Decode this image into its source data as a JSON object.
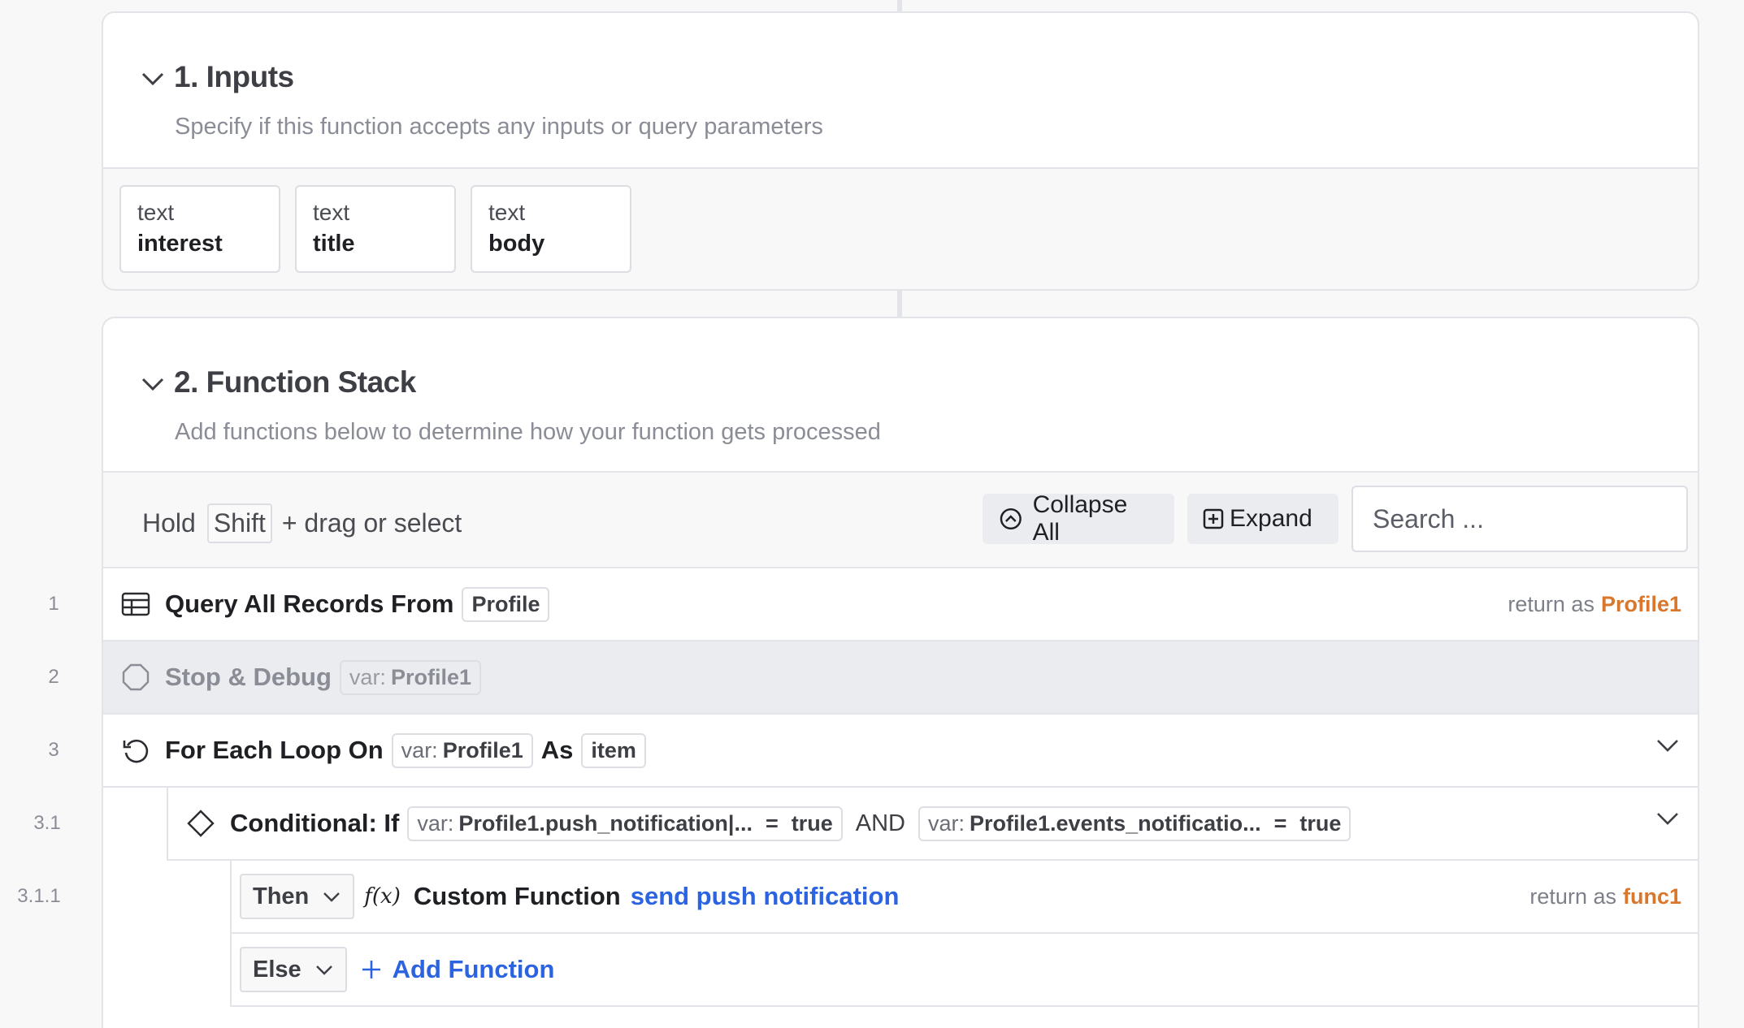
{
  "inputs": {
    "title": "1. Inputs",
    "subtitle": "Specify if this function accepts any inputs or query parameters",
    "items": [
      {
        "type": "text",
        "name": "interest"
      },
      {
        "type": "text",
        "name": "title"
      },
      {
        "type": "text",
        "name": "body"
      }
    ]
  },
  "stack": {
    "title": "2. Function Stack",
    "subtitle": "Add functions below to determine how your function gets processed",
    "toolbar": {
      "hold": "Hold",
      "key": "Shift",
      "hint": "+ drag or select",
      "collapse_all": "Collapse All",
      "expand": "Expand",
      "search_placeholder": "Search ..."
    },
    "rows": [
      {
        "line": "1",
        "label": "Query All Records From",
        "table": "Profile",
        "return_prefix": "return as",
        "return_var": "Profile1"
      },
      {
        "line": "2",
        "label": "Stop & Debug",
        "var_prefix": "var:",
        "var": "Profile1"
      },
      {
        "line": "3",
        "label": "For Each Loop On",
        "var_prefix": "var:",
        "var": "Profile1",
        "as_label": "As",
        "item": "item"
      },
      {
        "line": "3.1",
        "label": "Conditional: If",
        "cond1_prefix": "var:",
        "cond1_var": "Profile1.push_notification|...",
        "cond1_op": "=",
        "cond1_val": "true",
        "joiner": "AND",
        "cond2_prefix": "var:",
        "cond2_var": "Profile1.events_notificatio...",
        "cond2_op": "=",
        "cond2_val": "true"
      },
      {
        "line": "3.1.1",
        "branch": "Then",
        "fx": "f(x)",
        "label": "Custom Function",
        "function": "send push notification",
        "return_prefix": "return as",
        "return_var": "func1"
      },
      {
        "branch": "Else",
        "add_label": "Add Function"
      }
    ]
  },
  "colors": {
    "accent_link": "#2c63e0",
    "return_var": "#d9772d",
    "debug_row_bg": "#ebecef"
  }
}
